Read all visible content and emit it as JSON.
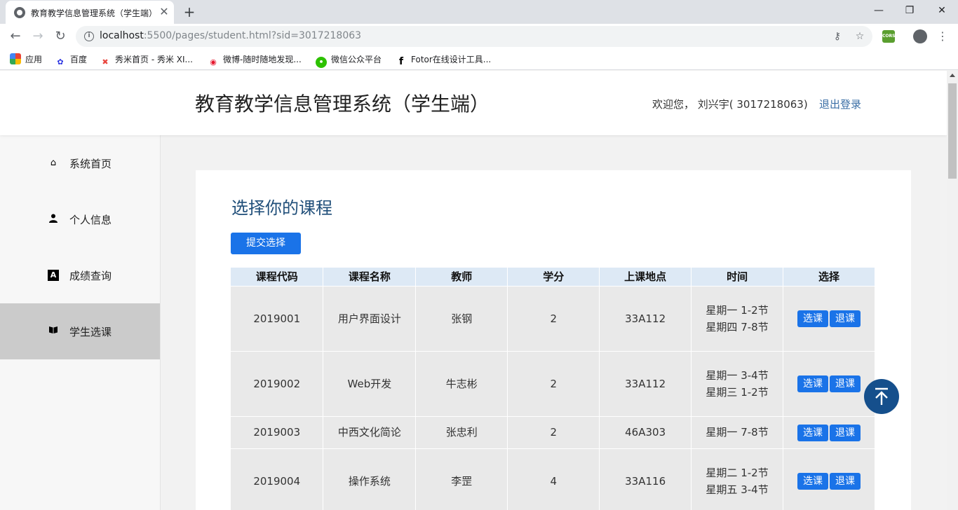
{
  "browser": {
    "tab_title": "教育教学信息管理系统（学生端）",
    "url_host": "localhost",
    "url_rest": ":5500/pages/student.html?sid=3017218063",
    "bookmarks": [
      {
        "label": "应用",
        "icon": "apps-grid-icon"
      },
      {
        "label": "百度",
        "icon": "baidu-icon"
      },
      {
        "label": "秀米首页 - 秀米 XI...",
        "icon": "xiumi-icon"
      },
      {
        "label": "微博-随时随地发现...",
        "icon": "weibo-icon"
      },
      {
        "label": "微信公众平台",
        "icon": "wechat-icon"
      },
      {
        "label": "Fotor在线设计工具...",
        "icon": "fotor-icon"
      }
    ],
    "cors_label": "CORS"
  },
  "header": {
    "title": "教育教学信息管理系统（学生端）",
    "welcome": "欢迎您， 刘兴宇( 3017218063)",
    "logout": "退出登录"
  },
  "sidebar": {
    "items": [
      {
        "label": "系统首页",
        "icon": "home-icon",
        "active": false
      },
      {
        "label": "个人信息",
        "icon": "user-icon",
        "active": false
      },
      {
        "label": "成绩查询",
        "icon": "font-a-icon",
        "active": false
      },
      {
        "label": "学生选课",
        "icon": "book-icon",
        "active": true
      }
    ]
  },
  "main": {
    "title": "选择你的课程",
    "submit_label": "提交选择",
    "table": {
      "headers": [
        "课程代码",
        "课程名称",
        "教师",
        "学分",
        "上课地点",
        "时间",
        "选择"
      ],
      "rows": [
        [
          "2019001",
          "用户界面设计",
          "张钢",
          "2",
          "33A112",
          "星期一 1-2节 星期四 7-8节"
        ],
        [
          "2019002",
          "Web开发",
          "牛志彬",
          "2",
          "33A112",
          "星期一 3-4节 星期三 1-2节"
        ],
        [
          "2019003",
          "中西文化简论",
          "张忠利",
          "2",
          "46A303",
          "星期一 7-8节"
        ],
        [
          "2019004",
          "操作系统",
          "李罡",
          "4",
          "33A116",
          "星期二 1-2节 星期五 3-4节"
        ]
      ],
      "select_label": "选课",
      "drop_label": "退课"
    }
  },
  "colors": {
    "accent": "#1a73e8",
    "title_blue": "#1f4e79",
    "back_top": "#154f8c",
    "sidebar_active": "#cbcbcb",
    "table_header": "#dde9f5"
  }
}
